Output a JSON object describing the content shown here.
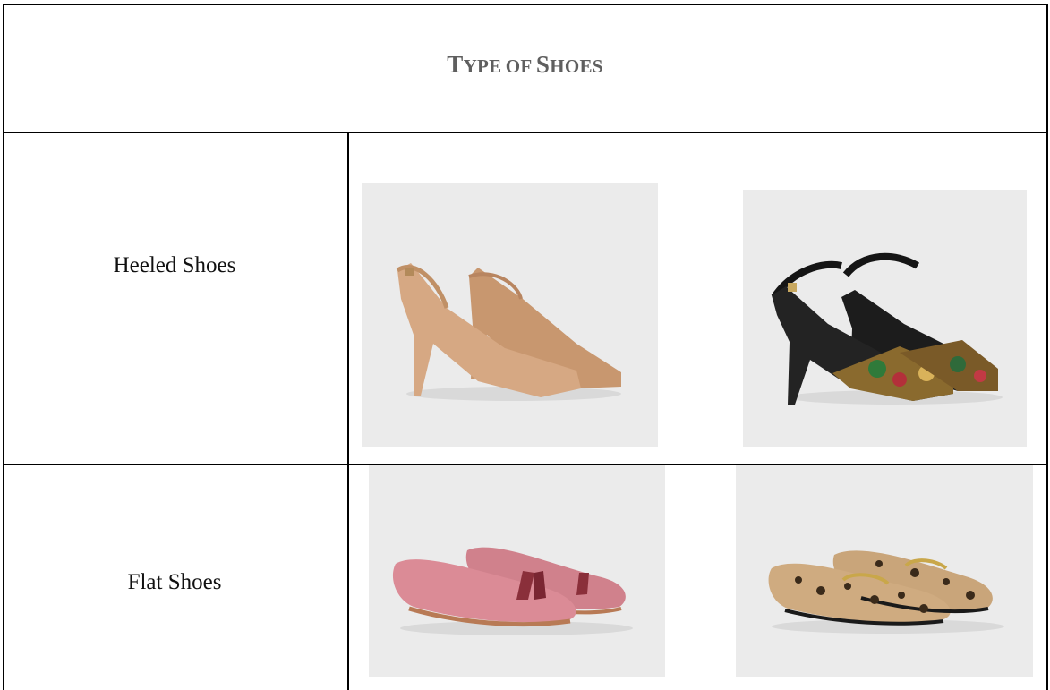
{
  "title": {
    "cap1": "T",
    "rest1": "ype",
    "mid": "of",
    "cap2": "S",
    "rest2": "hoes"
  },
  "rows": [
    {
      "label": "Heeled Shoes",
      "images": [
        {
          "icon": "nude-slingback-pumps-image",
          "color": "#d2a47d"
        },
        {
          "icon": "patterned-ankle-strap-heels-image",
          "color": "#1a1a1a"
        }
      ]
    },
    {
      "label": "Flat Shoes",
      "images": [
        {
          "icon": "pink-tassel-loafers-image",
          "color": "#d98a94"
        },
        {
          "icon": "leopard-print-loafers-image",
          "color": "#c9a57a"
        }
      ]
    }
  ]
}
